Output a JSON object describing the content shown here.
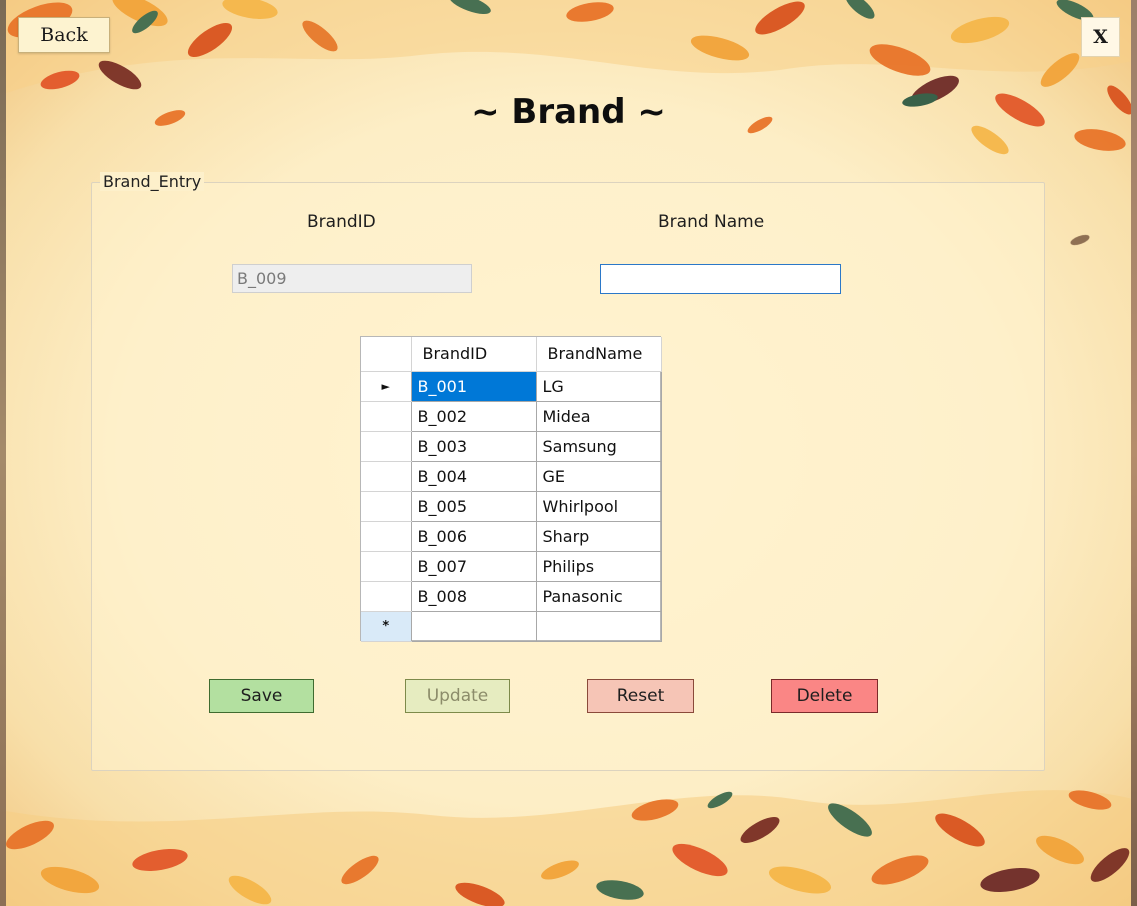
{
  "window": {
    "back_label": "Back",
    "close_label": "X",
    "title": "~ Brand ~"
  },
  "form": {
    "group_label": "Brand_Entry",
    "brand_id_label": "BrandID",
    "brand_name_label": "Brand Name",
    "brand_id_value": "B_009",
    "brand_name_value": ""
  },
  "grid": {
    "columns": [
      "BrandID",
      "BrandName"
    ],
    "rows": [
      {
        "id": "B_001",
        "name": "LG"
      },
      {
        "id": "B_002",
        "name": "Midea"
      },
      {
        "id": "B_003",
        "name": "Samsung"
      },
      {
        "id": "B_004",
        "name": "GE"
      },
      {
        "id": "B_005",
        "name": "Whirlpool"
      },
      {
        "id": "B_006",
        "name": "Sharp"
      },
      {
        "id": "B_007",
        "name": "Philips"
      },
      {
        "id": "B_008",
        "name": "Panasonic"
      }
    ],
    "current_row_marker": "►",
    "new_row_marker": "*"
  },
  "buttons": {
    "save": "Save",
    "update": "Update",
    "reset": "Reset",
    "delete": "Delete"
  },
  "colors": {
    "background": "#fff2cf",
    "selection": "#0078d7",
    "save": "#b3e0a0",
    "update": "#e6ecc0",
    "reset": "#f6c5b6",
    "delete": "#fa8685"
  }
}
